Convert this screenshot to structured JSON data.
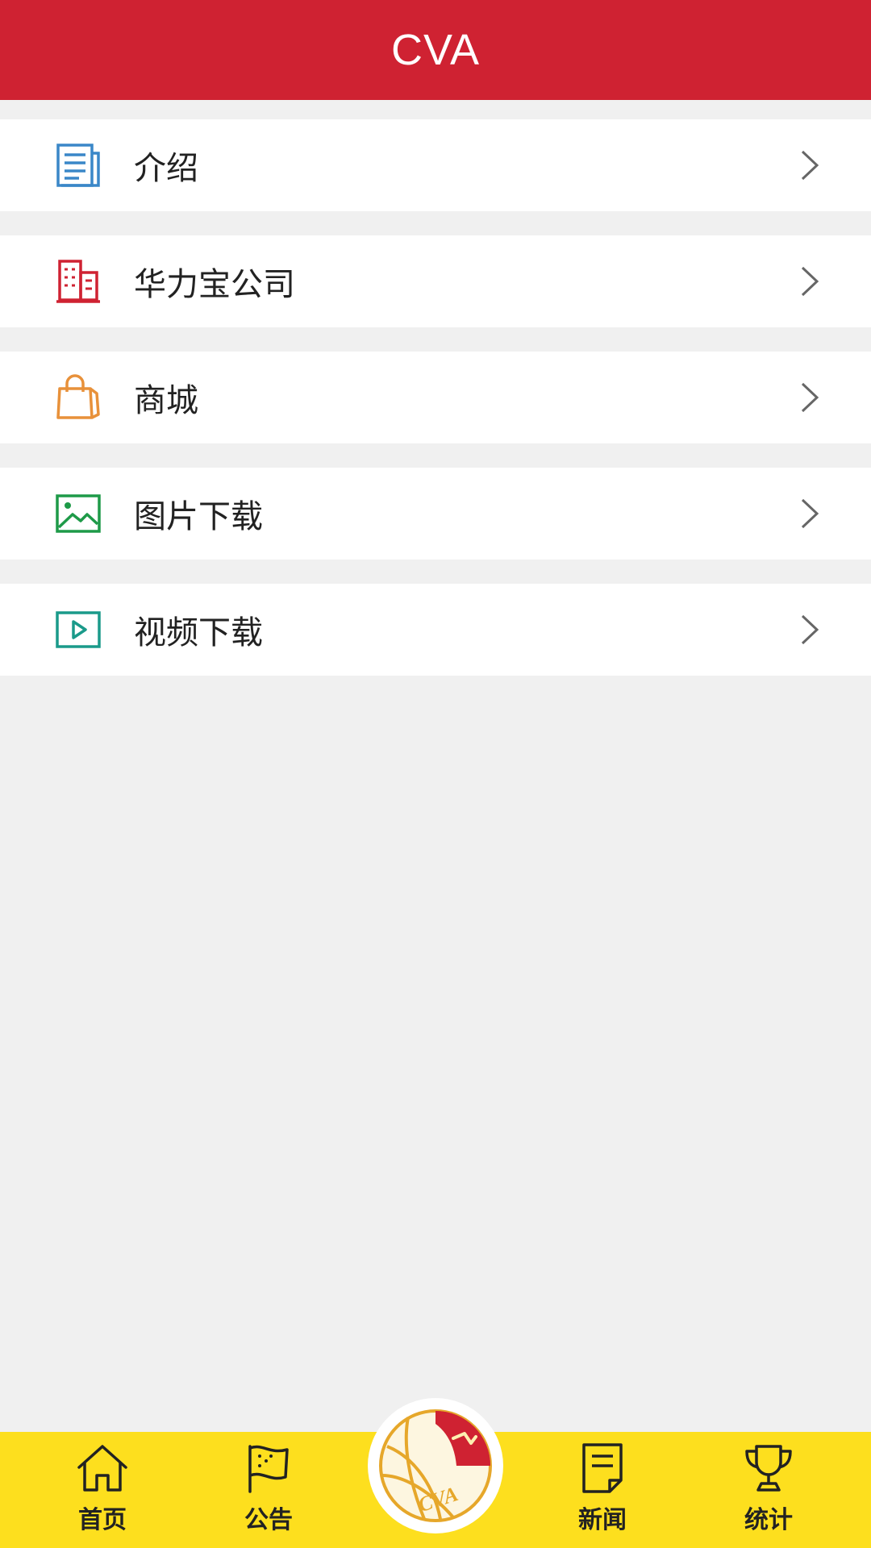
{
  "header": {
    "title": "CVA"
  },
  "menu": {
    "items": [
      {
        "label": "介绍",
        "icon": "document-icon",
        "color": "#3a87c8"
      },
      {
        "label": "华力宝公司",
        "icon": "building-icon",
        "color": "#cf2232"
      },
      {
        "label": "商城",
        "icon": "shopping-bag-icon",
        "color": "#e8913a"
      },
      {
        "label": "图片下载",
        "icon": "image-icon",
        "color": "#1e9a48"
      },
      {
        "label": "视频下载",
        "icon": "video-icon",
        "color": "#1a9a8a"
      }
    ]
  },
  "tabbar": {
    "tabs": [
      {
        "label": "首页",
        "icon": "home-icon"
      },
      {
        "label": "公告",
        "icon": "flag-icon"
      },
      {
        "label": "新闻",
        "icon": "news-icon"
      },
      {
        "label": "统计",
        "icon": "trophy-icon"
      }
    ],
    "center": {
      "icon": "cva-logo-icon",
      "logo_text": "CVA"
    }
  },
  "colors": {
    "header_bg": "#cf2232",
    "tabbar_bg": "#fddf1e",
    "page_bg": "#f0f0f0"
  }
}
